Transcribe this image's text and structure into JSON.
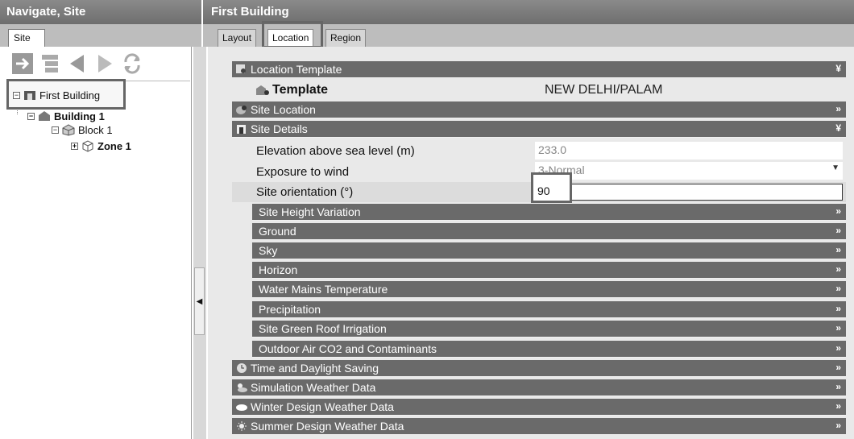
{
  "nav": {
    "title": "Navigate, Site",
    "tab": "Site",
    "tree": {
      "first_building": "First Building",
      "building_1": "Building 1",
      "block_1": "Block 1",
      "zone_1": "Zone 1"
    }
  },
  "main": {
    "title": "First Building",
    "tabs": [
      "Layout",
      "Location",
      "Region"
    ],
    "active_tab": "Location"
  },
  "location_template": {
    "header": "Location Template",
    "template_label": "Template",
    "template_value": "NEW DELHI/PALAM"
  },
  "site_location": {
    "header": "Site Location"
  },
  "site_details": {
    "header": "Site Details",
    "elevation_label": "Elevation above sea level (m)",
    "elevation_value": "233.0",
    "exposure_label": "Exposure to wind",
    "exposure_value": "3-Normal",
    "orientation_label": "Site orientation (°)",
    "orientation_value": "90",
    "subsections": [
      "Site Height Variation",
      "Ground",
      "Sky",
      "Horizon",
      "Water Mains Temperature",
      "Precipitation",
      "Site Green Roof Irrigation",
      "Outdoor Air CO2 and Contaminants"
    ]
  },
  "sections": [
    "Time and Daylight Saving",
    "Simulation Weather Data",
    "Winter Design Weather Data",
    "Summer Design Weather Data"
  ],
  "symbols": {
    "expand": "»",
    "collapse": "¥"
  },
  "colors": {
    "bar": "#6a6a6a",
    "title": "#7a7a7a",
    "highlight": "#666666"
  }
}
